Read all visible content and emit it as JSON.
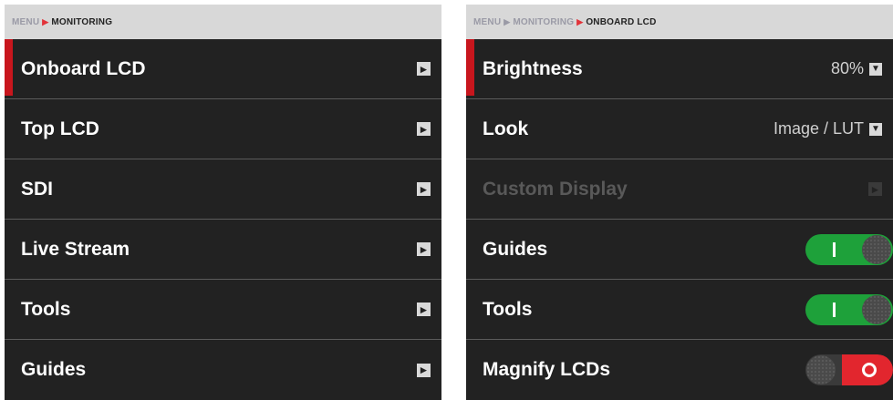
{
  "left": {
    "breadcrumb": {
      "menu": "MENU",
      "current": "MONITORING"
    },
    "items": [
      {
        "label": "Onboard LCD",
        "active": true
      },
      {
        "label": "Top LCD"
      },
      {
        "label": "SDI"
      },
      {
        "label": "Live Stream"
      },
      {
        "label": "Tools"
      },
      {
        "label": "Guides"
      }
    ]
  },
  "right": {
    "breadcrumb": {
      "menu": "MENU",
      "parent": "MONITORING",
      "current": "ONBOARD LCD"
    },
    "items": {
      "brightness": {
        "label": "Brightness",
        "value": "80%"
      },
      "look": {
        "label": "Look",
        "value": "Image / LUT"
      },
      "custom_display": {
        "label": "Custom Display",
        "enabled": false
      },
      "guides": {
        "label": "Guides",
        "state": "on"
      },
      "tools": {
        "label": "Tools",
        "state": "on"
      },
      "magnify_lcds": {
        "label": "Magnify LCDs",
        "state": "off"
      }
    }
  },
  "colors": {
    "panel_bg": "#222222",
    "breadcrumb_bg": "#d8d8d8",
    "accent_red": "#c8161d",
    "toggle_on": "#1ea13a",
    "toggle_off": "#e2262e"
  },
  "icons": {
    "crumb_separator": "chevron-right-icon",
    "nav_arrow": "chevron-right-icon",
    "dropdown": "caret-down-icon"
  }
}
